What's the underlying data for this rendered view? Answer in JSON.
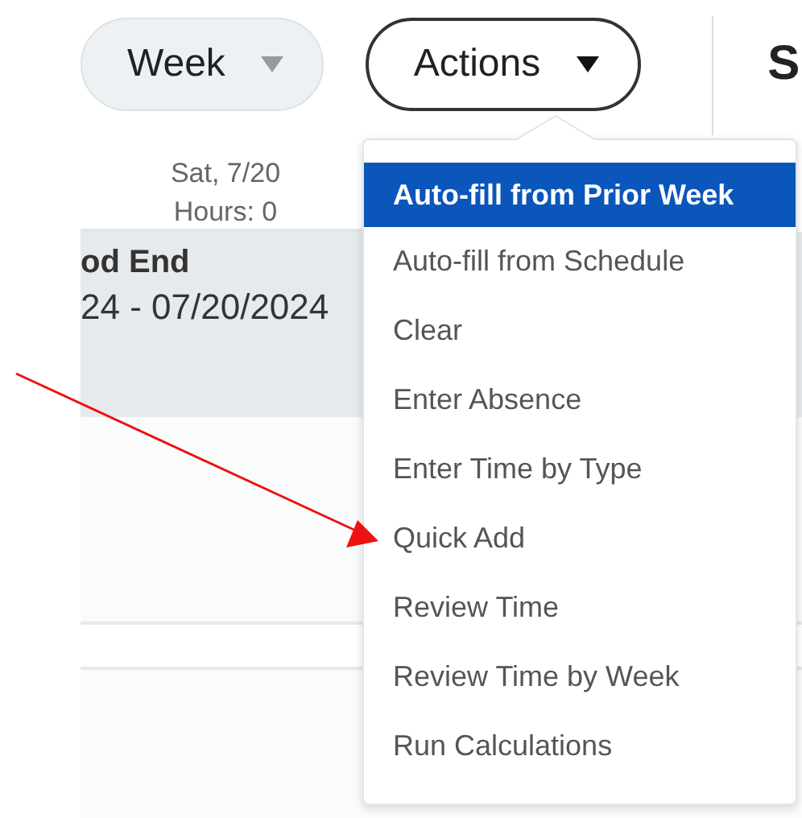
{
  "toolbar": {
    "view_select": {
      "value": "Week"
    },
    "actions_button": {
      "label": "Actions"
    },
    "heading": "S"
  },
  "day_header": {
    "day": "Sat, 7/20",
    "hours": "Hours: 0"
  },
  "period_row": {
    "title": "od End",
    "range": "24 - 07/20/2024"
  },
  "actions_menu": {
    "items": [
      {
        "label": "Auto-fill from Prior Week",
        "selected": true
      },
      {
        "label": "Auto-fill from Schedule",
        "selected": false
      },
      {
        "label": "Clear",
        "selected": false
      },
      {
        "label": "Enter Absence",
        "selected": false
      },
      {
        "label": "Enter Time by Type",
        "selected": false
      },
      {
        "label": "Quick Add",
        "selected": false
      },
      {
        "label": "Review Time",
        "selected": false
      },
      {
        "label": "Review Time by Week",
        "selected": false
      },
      {
        "label": "Run Calculations",
        "selected": false
      }
    ]
  },
  "annotation": {
    "kind": "arrow"
  }
}
